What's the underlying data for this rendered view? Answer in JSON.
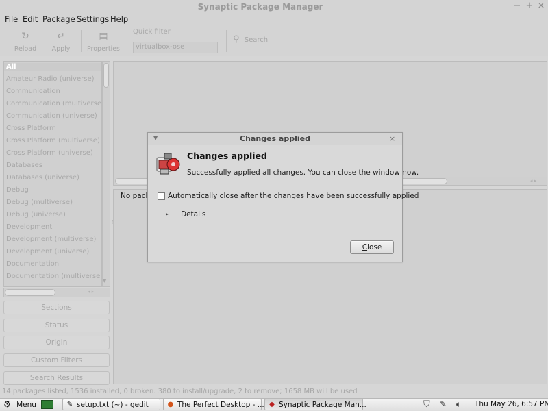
{
  "window": {
    "title": "Synaptic Package Manager",
    "minimize": "−",
    "maximize": "+",
    "close": "×"
  },
  "menubar": {
    "items": [
      {
        "u": "F",
        "rest": "ile"
      },
      {
        "u": "E",
        "rest": "dit"
      },
      {
        "u": "P",
        "rest": "ackage"
      },
      {
        "u": "S",
        "rest": "ettings"
      },
      {
        "u": "H",
        "rest": "elp"
      }
    ]
  },
  "toolbar": {
    "reload": "Reload",
    "apply": "Apply",
    "properties": "Properties",
    "quick_filter_label": "Quick filter",
    "quick_filter_value": "virtualbox-ose",
    "search": "Search"
  },
  "categories": [
    "All",
    "Amateur Radio (universe)",
    "Communication",
    "Communication (multiverse)",
    "Communication (universe)",
    "Cross Platform",
    "Cross Platform (multiverse)",
    "Cross Platform (universe)",
    "Databases",
    "Databases (universe)",
    "Debug",
    "Debug (multiverse)",
    "Debug (universe)",
    "Development",
    "Development (multiverse)",
    "Development (universe)",
    "Documentation",
    "Documentation (multiverse)"
  ],
  "side_buttons": {
    "sections": "Sections",
    "status": "Status",
    "origin": "Origin",
    "custom_filters": "Custom Filters",
    "search_results": "Search Results"
  },
  "description": {
    "text": "No pack"
  },
  "statusbar": {
    "text": "14 packages listed, 1536 installed, 0 broken. 380 to install/upgrade, 2 to remove; 1658 MB will be used"
  },
  "dialog": {
    "title": "Changes applied",
    "heading": "Changes applied",
    "message": "Successfully applied all changes. You can close the window now.",
    "checkbox_label": "Automatically close after the changes have been successfully applied",
    "checkbox_checked": false,
    "details": "Details",
    "close_button_u": "C",
    "close_button_rest": "lose"
  },
  "taskbar": {
    "menu": "Menu",
    "windows": [
      "setup.txt (~) - gedit",
      "The Perfect Desktop - ...",
      "Synaptic Package Man..."
    ],
    "clock": "Thu May 26,  6:57 PM"
  }
}
